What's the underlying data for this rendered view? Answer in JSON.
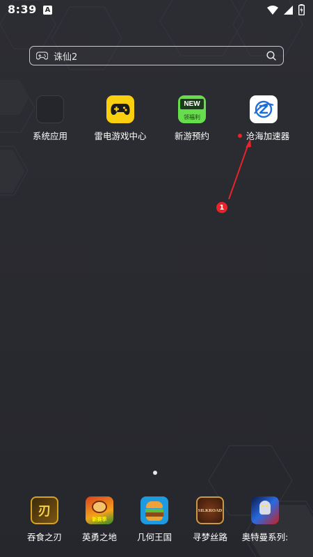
{
  "status_bar": {
    "time": "8:39",
    "notification_icon": "A"
  },
  "search": {
    "query": "诛仙2"
  },
  "apps": [
    {
      "label": "系统应用",
      "icon": "folder-icon"
    },
    {
      "label": "雷电游戏中心",
      "icon": "gamepad-icon"
    },
    {
      "label": "新游预约",
      "icon": "new-badge-icon"
    },
    {
      "label": "沧海加速器",
      "icon": "accelerator-icon",
      "badge": "new-dot"
    }
  ],
  "annotation": {
    "step": "1",
    "color": "#e8232a"
  },
  "new_badge": {
    "title": "NEW",
    "sub": "领福利"
  },
  "dock": [
    {
      "label": "吞食之刃",
      "badge_text": "刃"
    },
    {
      "label": "英勇之地",
      "badge_text": "新赛季"
    },
    {
      "label": "几何王国"
    },
    {
      "label": "寻梦丝路",
      "badge_text": "SILKROAD"
    },
    {
      "label": "奥特曼系列:"
    }
  ],
  "colors": {
    "accent_yellow": "#f9cf0f",
    "accent_green": "#66dd4a",
    "accent_blue": "#1f6fd8",
    "annotation_red": "#e8232a"
  }
}
